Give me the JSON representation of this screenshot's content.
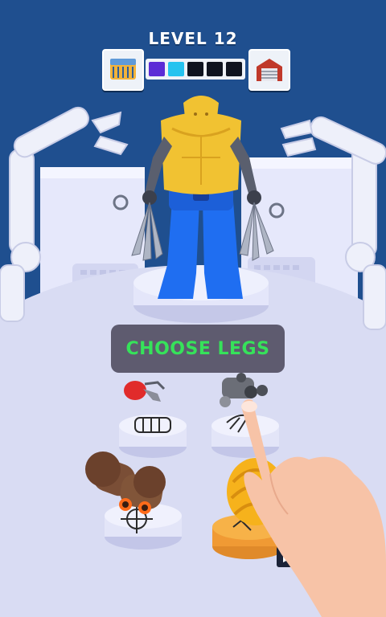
{
  "header": {
    "level_label": "LEVEL 12"
  },
  "progress": {
    "left_icon": "lab-cage-icon",
    "right_icon": "garage-icon",
    "steps": [
      {
        "color": "#5b2bd6",
        "state": "done"
      },
      {
        "color": "#25c3ef",
        "state": "current"
      },
      {
        "color": "#0f1420",
        "state": "locked"
      },
      {
        "color": "#0f1420",
        "state": "locked"
      },
      {
        "color": "#0f1420",
        "state": "locked"
      }
    ]
  },
  "prompt": {
    "label": "CHOOSE LEGS"
  },
  "options": [
    {
      "name": "red-claw-part",
      "icon": "fist-icon"
    },
    {
      "name": "minigun-part",
      "icon": "claw-icon"
    },
    {
      "name": "cannon-part",
      "icon": "target-icon"
    },
    {
      "name": "orange-coil-part",
      "icon": "coil-icon"
    }
  ],
  "colors": {
    "sky": "#1f4f8f",
    "floor": "#d9dcf3",
    "hero_body": "#f1c232",
    "hero_legs": "#1f6ef1",
    "accent_text": "#36e25a"
  }
}
